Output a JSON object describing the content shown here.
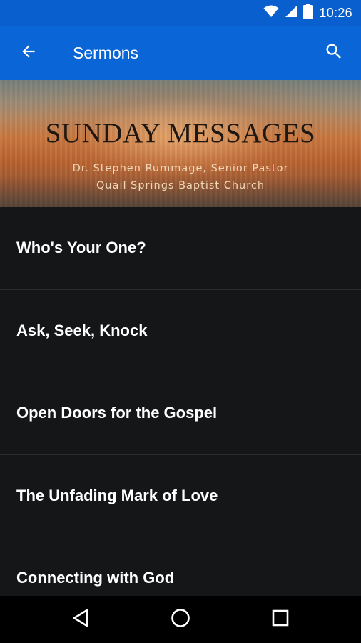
{
  "status_bar": {
    "time": "10:26",
    "icons": [
      "wifi-icon",
      "cell-signal-icon",
      "battery-icon"
    ]
  },
  "app_bar": {
    "title": "Sermons",
    "back_icon": "arrow-back-icon",
    "search_icon": "search-icon",
    "background_color": "#0a66d6"
  },
  "banner": {
    "title": "SUNDAY MESSAGES",
    "line1": "Dr. Stephen Rummage, Senior Pastor",
    "line2": "Quail Springs Baptist Church"
  },
  "sermons": [
    {
      "title": "Who's Your One?"
    },
    {
      "title": "Ask, Seek, Knock"
    },
    {
      "title": "Open Doors for the Gospel"
    },
    {
      "title": "The Unfading Mark of Love"
    },
    {
      "title": "Connecting with God"
    }
  ],
  "nav_bar": {
    "icons": [
      "nav-back-icon",
      "nav-home-icon",
      "nav-recents-icon"
    ]
  }
}
